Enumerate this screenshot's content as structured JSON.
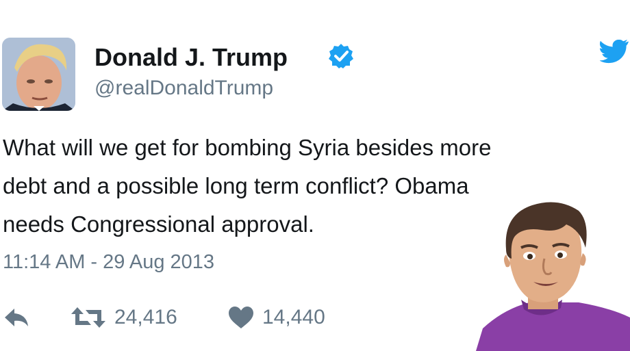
{
  "tweet": {
    "display_name": "Donald J. Trump",
    "handle": "@realDonaldTrump",
    "text_lines": [
      "What will we get for bombing Syria besides more",
      "debt and a possible long term conflict? Obama",
      "needs Congressional approval."
    ],
    "timestamp": "11:14 AM - 29 Aug 2013",
    "retweet_count": "24,416",
    "like_count": "14,440",
    "verified": true
  },
  "icons": {
    "avatar": "profile-photo",
    "verified": "verified-badge-icon",
    "brand": "twitter-bird-icon",
    "reply": "reply-icon",
    "retweet": "retweet-icon",
    "like": "heart-icon",
    "sticker": "meme-face-sticker"
  },
  "colors": {
    "text": "#14171a",
    "secondary": "#657786",
    "brand_blue": "#1da1f2",
    "sticker_shirt": "#8a3fa6"
  }
}
